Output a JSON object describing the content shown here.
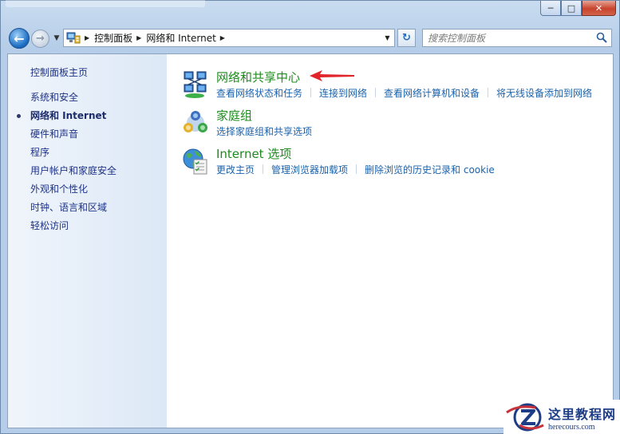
{
  "window": {
    "caption_min": "─",
    "caption_max": "□",
    "caption_close": "✕"
  },
  "navigation": {
    "back_glyph": "←",
    "forward_glyph": "→",
    "recent_glyph": "▼",
    "breadcrumbs": [
      "控制面板",
      "网络和 Internet"
    ],
    "crumb_separator": "▶",
    "dropdown_glyph": "▼",
    "refresh_glyph": "↻"
  },
  "search": {
    "placeholder": "搜索控制面板"
  },
  "sidebar": {
    "home": "控制面板主页",
    "items": [
      {
        "label": "系统和安全",
        "active": false
      },
      {
        "label": "网络和 Internet",
        "active": true
      },
      {
        "label": "硬件和声音",
        "active": false
      },
      {
        "label": "程序",
        "active": false
      },
      {
        "label": "用户帐户和家庭安全",
        "active": false
      },
      {
        "label": "外观和个性化",
        "active": false
      },
      {
        "label": "时钟、语言和区域",
        "active": false
      },
      {
        "label": "轻松访问",
        "active": false
      }
    ]
  },
  "categories": [
    {
      "title": "网络和共享中心",
      "icon": "network-icon",
      "links": [
        "查看网络状态和任务",
        "连接到网络",
        "查看网络计算机和设备",
        "将无线设备添加到网络"
      ]
    },
    {
      "title": "家庭组",
      "icon": "homegroup-icon",
      "links": [
        "选择家庭组和共享选项"
      ]
    },
    {
      "title": "Internet 选项",
      "icon": "internet-options-icon",
      "links": [
        "更改主页",
        "管理浏览器加载项",
        "删除浏览的历史记录和 cookie"
      ]
    }
  ],
  "colors": {
    "category_title": "#1f8a1f",
    "link": "#1b62ab",
    "sidebar_text": "#1e3287",
    "annotation_arrow": "#e0242a"
  },
  "watermark": {
    "cn": "这里教程网",
    "en": "herecours.com"
  }
}
